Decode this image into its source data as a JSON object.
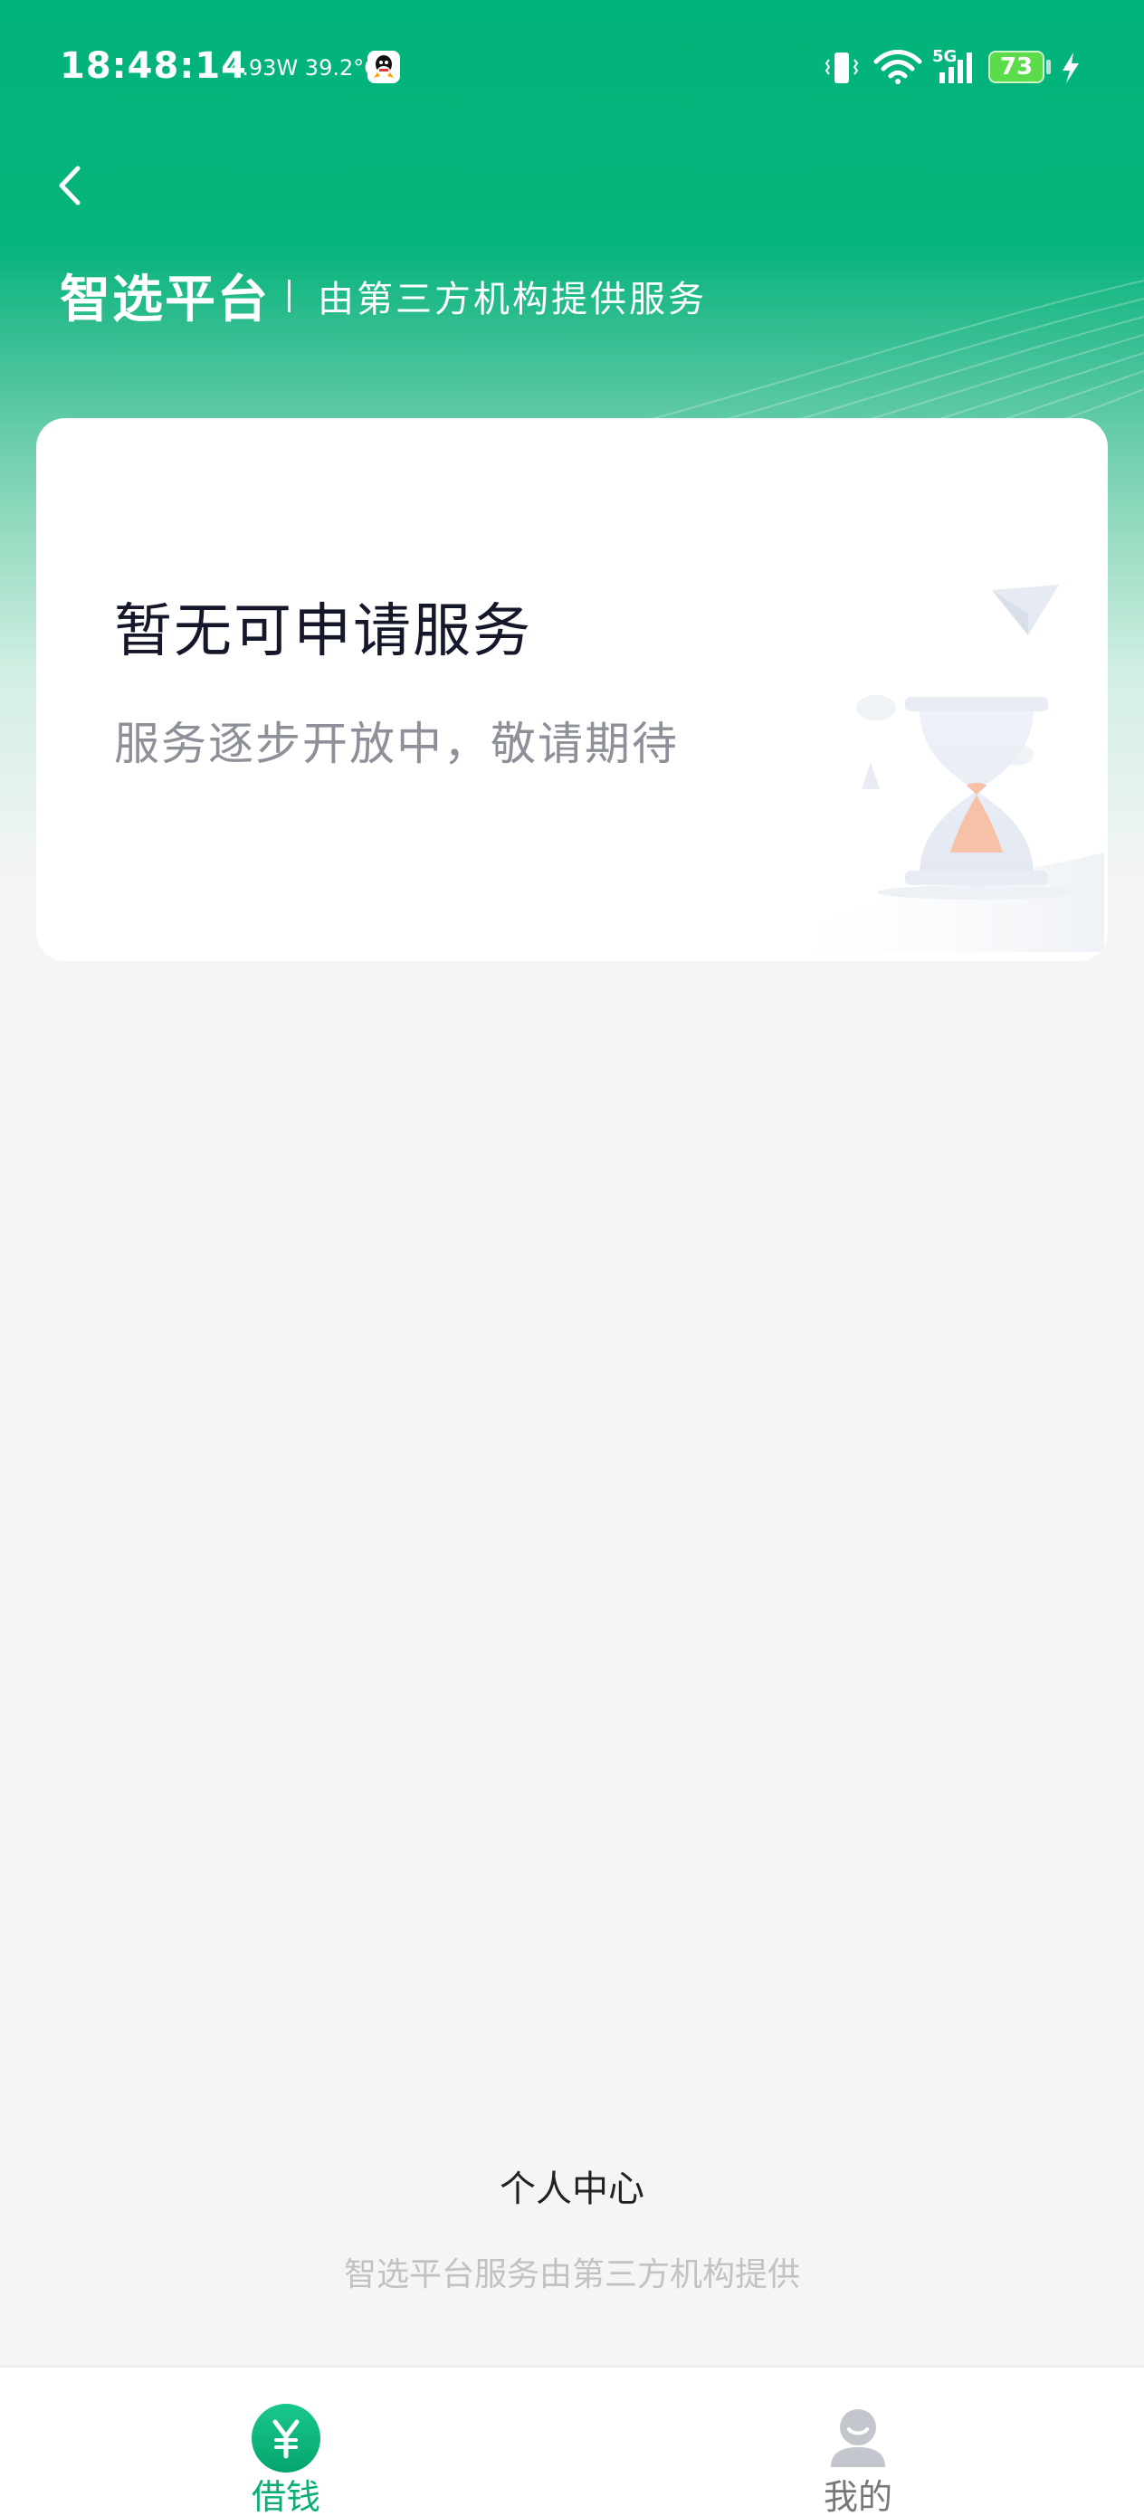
{
  "status_bar": {
    "time": "18:48:14",
    "power_info": "4.93W 39.2°C",
    "network": "5G",
    "battery": "73"
  },
  "header": {
    "title": "智选平台",
    "subtitle": "由第三方机构提供服务"
  },
  "card": {
    "title": "暂无可申请服务",
    "description": "服务逐步开放中，敬请期待"
  },
  "footer": {
    "personal_center": "个人中心",
    "note": "智选平台服务由第三方机构提供"
  },
  "tabs": [
    {
      "label": "借钱",
      "icon": "yen-icon",
      "active": true
    },
    {
      "label": "我的",
      "icon": "user-icon",
      "active": false
    }
  ],
  "colors": {
    "brand_green": "#00b37a",
    "tab_active": "#0aae74"
  }
}
